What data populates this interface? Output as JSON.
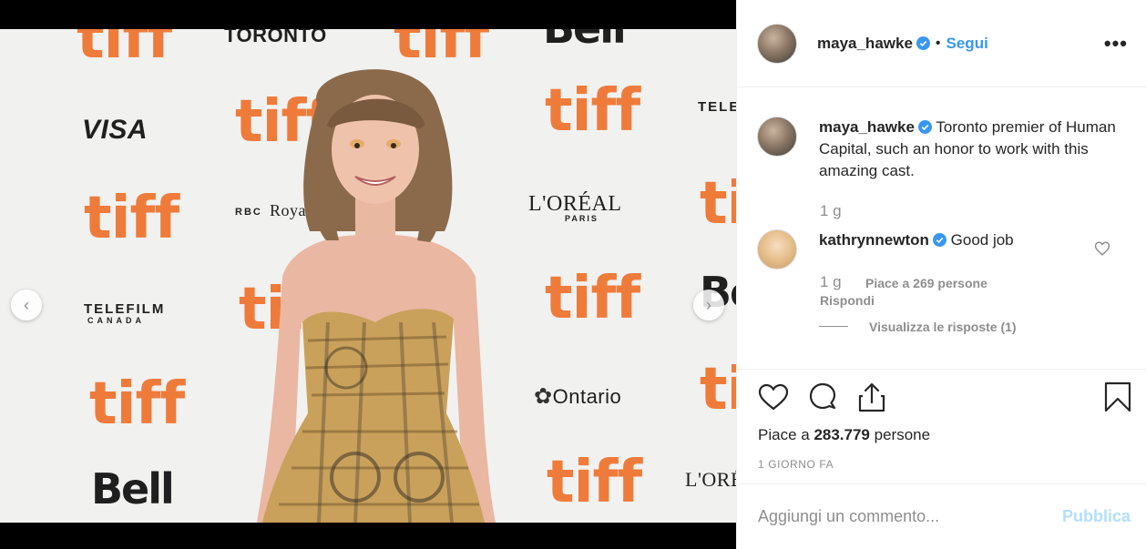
{
  "media": {
    "backdrop": {
      "tiff": "tiff",
      "visa": "VISA",
      "toronto": "TORONTO",
      "bell": "Bell",
      "telefilm": "TELEFILM",
      "canada": "CANADA",
      "loreal": "L'ORÉAL",
      "paris": "PARIS",
      "ontario": "Ontario",
      "royal_bank": "Royal Bank",
      "rbc": "RBC",
      "tele": "TELE"
    },
    "carousel_prev": "‹",
    "carousel_next": "›"
  },
  "post": {
    "author": "maya_hawke",
    "bullet": "•",
    "follow_label": "Segui",
    "more_label": "•••",
    "caption_user": "maya_hawke",
    "caption_text": "Toronto premier of Human Capital, such an honor to work with this amazing cast.",
    "caption_time": "1 g",
    "comments": [
      {
        "user": "kathrynnewton",
        "text": "Good job",
        "time": "1 g",
        "likes": "Piace a 269 persone",
        "reply": "Rispondi",
        "view_replies": "Visualizza le risposte (1)"
      }
    ],
    "likes_prefix": "Piace a",
    "likes_count": "283.779",
    "likes_suffix": "persone",
    "timestamp": "1 GIORNO FA",
    "comment_placeholder": "Aggiungi un commento...",
    "publish_label": "Pubblica"
  },
  "colors": {
    "accent": "#3897f0",
    "tiff_orange": "#ef7b3b",
    "muted": "#8e8e8e"
  },
  "icons": [
    "verified-badge-icon",
    "heart-icon",
    "comment-icon",
    "share-icon",
    "bookmark-icon",
    "chevron-left-icon",
    "chevron-right-icon"
  ]
}
